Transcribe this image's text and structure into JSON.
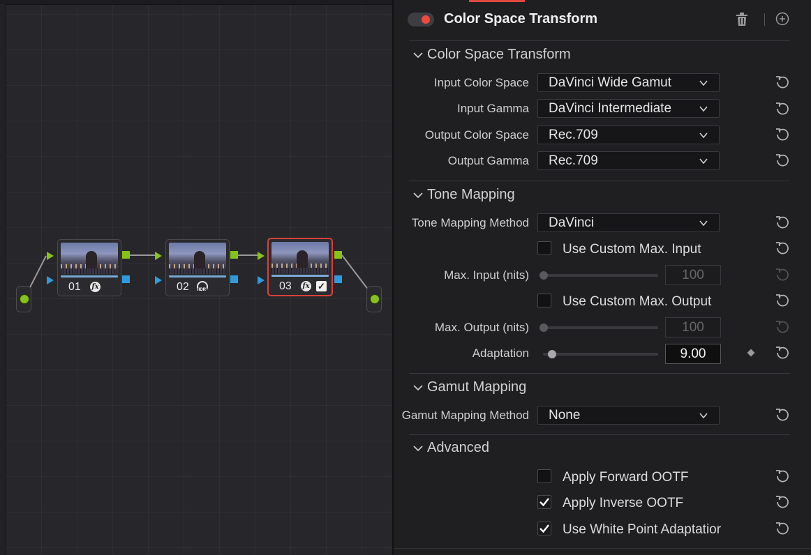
{
  "inspector": {
    "title": "Color Space Transform",
    "enabled": true,
    "sections": {
      "cst": "Color Space Transform",
      "tone": "Tone Mapping",
      "gamut": "Gamut Mapping",
      "advanced": "Advanced"
    },
    "fields": {
      "input_color_space": {
        "label": "Input Color Space",
        "value": "DaVinci Wide Gamut"
      },
      "input_gamma": {
        "label": "Input Gamma",
        "value": "DaVinci Intermediate"
      },
      "output_color_space": {
        "label": "Output Color Space",
        "value": "Rec.709"
      },
      "output_gamma": {
        "label": "Output Gamma",
        "value": "Rec.709"
      },
      "tone_mapping_method": {
        "label": "Tone Mapping Method",
        "value": "DaVinci"
      },
      "use_custom_max_input": {
        "label": "Use Custom Max. Input",
        "checked": false
      },
      "max_input": {
        "label": "Max. Input (nits)",
        "value": "100",
        "enabled": false
      },
      "use_custom_max_output": {
        "label": "Use Custom Max. Output",
        "checked": false
      },
      "max_output": {
        "label": "Max. Output (nits)",
        "value": "100",
        "enabled": false
      },
      "adaptation": {
        "label": "Adaptation",
        "value": "9.00"
      },
      "gamut_mapping_method": {
        "label": "Gamut Mapping Method",
        "value": "None"
      },
      "apply_forward_ootf": {
        "label": "Apply Forward OOTF",
        "checked": false
      },
      "apply_inverse_ootf": {
        "label": "Apply Inverse OOTF",
        "checked": true
      },
      "use_white_point_adaptation": {
        "label": "Use White Point Adaptatior",
        "checked": true
      }
    }
  },
  "node_graph": {
    "nodes": [
      {
        "number": "01",
        "icon": "fx-icon"
      },
      {
        "number": "02",
        "icon": "hdr-icon",
        "icon_text": "HDR"
      },
      {
        "number": "03",
        "icon": "fx-icon",
        "selected": true
      }
    ]
  },
  "colors": {
    "accent_red": "#e0483f",
    "rgb_input_green": "#86c21a",
    "alpha_blue": "#2f9bdc",
    "node_selected_border": "#d7413a"
  }
}
